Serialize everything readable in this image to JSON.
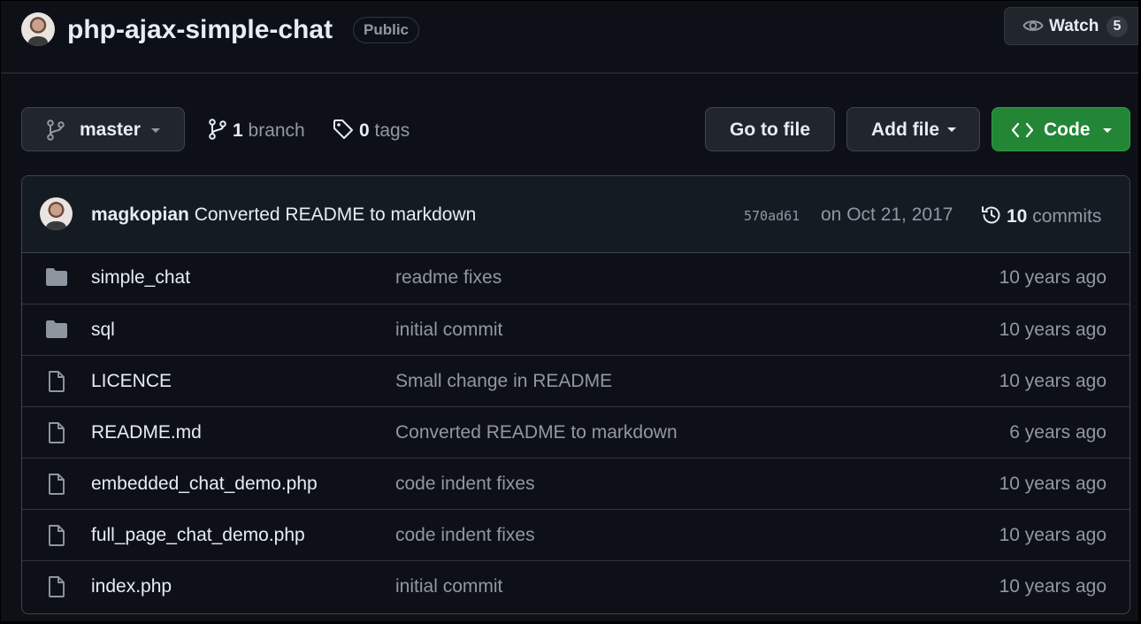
{
  "repo": {
    "name": "php-ajax-simple-chat",
    "visibility": "Public",
    "watch_label": "Watch",
    "watch_count": "5"
  },
  "toolbar": {
    "branch": "master",
    "branch_count": "1",
    "branch_word": "branch",
    "tag_count": "0",
    "tag_word": "tags",
    "goto_file": "Go to file",
    "add_file": "Add file",
    "code": "Code"
  },
  "commit": {
    "author": "magkopian",
    "message": "Converted README to markdown",
    "sha": "570ad61",
    "date": "on Oct 21, 2017",
    "count": "10",
    "count_word": "commits"
  },
  "files": [
    {
      "name": "simple_chat",
      "type": "folder",
      "message": "readme fixes",
      "age": "10 years ago"
    },
    {
      "name": "sql",
      "type": "folder",
      "message": "initial commit",
      "age": "10 years ago"
    },
    {
      "name": "LICENCE",
      "type": "file",
      "message": "Small change in README",
      "age": "10 years ago"
    },
    {
      "name": "README.md",
      "type": "file",
      "message": "Converted README to markdown",
      "age": "6 years ago"
    },
    {
      "name": "embedded_chat_demo.php",
      "type": "file",
      "message": "code indent fixes",
      "age": "10 years ago"
    },
    {
      "name": "full_page_chat_demo.php",
      "type": "file",
      "message": "code indent fixes",
      "age": "10 years ago"
    },
    {
      "name": "index.php",
      "type": "file",
      "message": "initial commit",
      "age": "10 years ago"
    }
  ],
  "colors": {
    "background": "#0d1117",
    "border": "#30363d",
    "muted": "#9198a1",
    "code_button": "#238636"
  }
}
